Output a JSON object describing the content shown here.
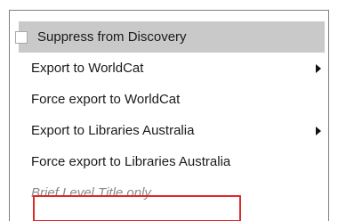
{
  "menu": {
    "items": [
      {
        "label": "Suppress from Discovery",
        "has_checkbox": true,
        "has_submenu": false,
        "state": "highlighted"
      },
      {
        "label": "Export to WorldCat",
        "has_checkbox": false,
        "has_submenu": true,
        "state": "normal"
      },
      {
        "label": "Force export to WorldCat",
        "has_checkbox": false,
        "has_submenu": false,
        "state": "normal"
      },
      {
        "label": "Export to Libraries Australia",
        "has_checkbox": false,
        "has_submenu": true,
        "state": "normal"
      },
      {
        "label": "Force export to Libraries Australia",
        "has_checkbox": false,
        "has_submenu": false,
        "state": "normal"
      },
      {
        "label": "Brief Level Title only",
        "has_checkbox": false,
        "has_submenu": false,
        "state": "disabled"
      }
    ],
    "submenu_icon": "triangle-right-icon",
    "checkbox_icon": "checkbox-icon"
  },
  "annotation": {
    "highlight_color": "#e02929"
  },
  "colors": {
    "highlight_background": "#c9c9c9",
    "menu_border": "#7f7f7f",
    "text": "#1a1a1a",
    "disabled_text": "#8a8a8a"
  }
}
